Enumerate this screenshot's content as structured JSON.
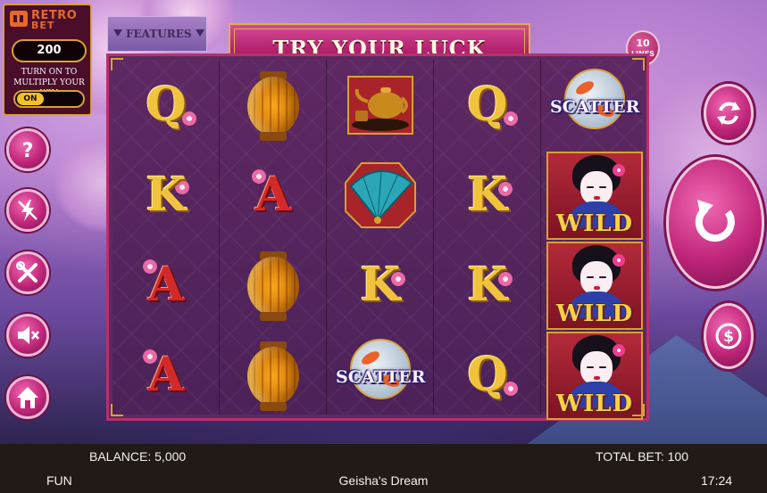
{
  "logo": {
    "line1": "RETRO",
    "line2": "BET"
  },
  "bet_panel": {
    "value": "200",
    "multiply_text": "TURN ON TO MULTIPLY YOUR WIN",
    "toggle_label": "ON"
  },
  "features": {
    "label": "FEATURES"
  },
  "banner": {
    "text": "TRY YOUR LUCK"
  },
  "lines": {
    "number": "10",
    "label": "LINES"
  },
  "reels": [
    [
      "Q",
      "K",
      "A",
      "A"
    ],
    [
      "lantern",
      "A",
      "lantern",
      "lantern"
    ],
    [
      "teapot",
      "fan",
      "K",
      "SCATTER"
    ],
    [
      "Q",
      "K",
      "K",
      "Q"
    ],
    [
      "SCATTER",
      "WILD",
      "WILD",
      "WILD"
    ]
  ],
  "symbols": {
    "scatter": "SCATTER",
    "wild": "WILD"
  },
  "left_buttons": [
    "help-icon",
    "lightning-off-icon",
    "settings-icon",
    "sound-off-icon",
    "home-icon"
  ],
  "right_buttons": [
    "autoplay-icon",
    "spin-icon",
    "bet-coin-icon"
  ],
  "status_bar": {
    "balance": "BALANCE: 5,000",
    "total_bet": "TOTAL BET: 100",
    "mode": "FUN",
    "game_title": "Geisha's Dream",
    "time": "17:24"
  },
  "colors": {
    "accent_pink": "#c1267a",
    "gold": "#d9a032",
    "bar": "#221a16"
  }
}
